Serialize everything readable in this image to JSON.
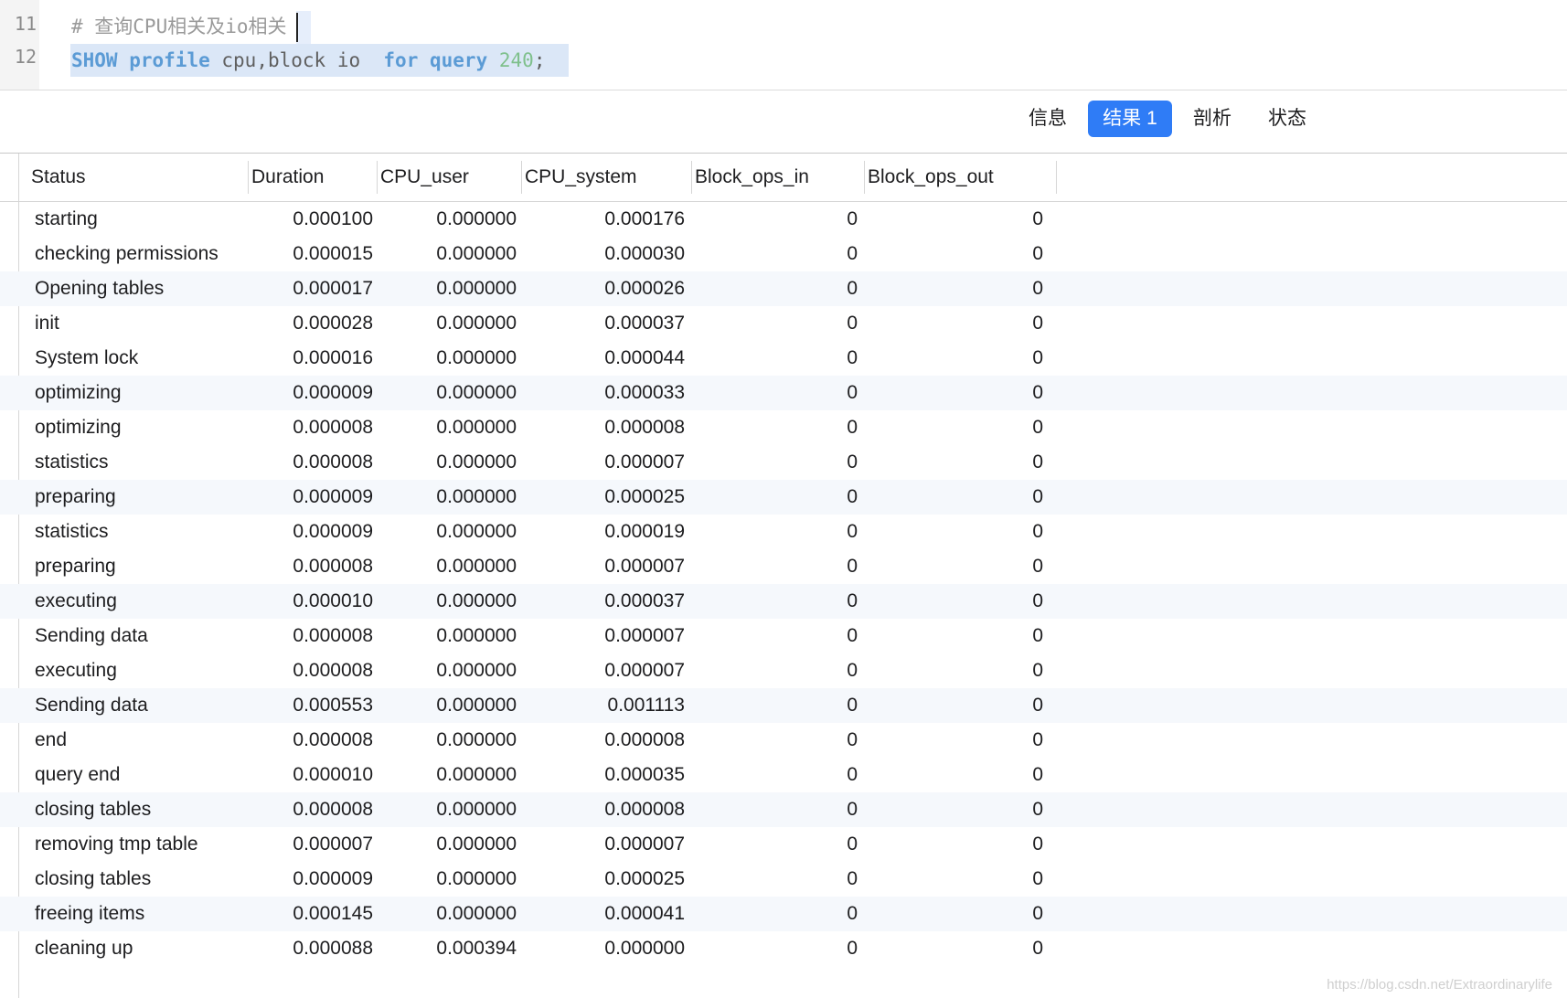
{
  "editor": {
    "lines": [
      {
        "num": "11",
        "comment": "# 查询CPU相关及io相关"
      },
      {
        "num": "12",
        "tokens": [
          {
            "t": "SHOW",
            "k": "kw"
          },
          {
            "t": " ",
            "k": "plain"
          },
          {
            "t": "profile",
            "k": "kw"
          },
          {
            "t": " cpu,block io  ",
            "k": "plain"
          },
          {
            "t": "for",
            "k": "kw"
          },
          {
            "t": " ",
            "k": "plain"
          },
          {
            "t": "query",
            "k": "kw"
          },
          {
            "t": " ",
            "k": "plain"
          },
          {
            "t": "240",
            "k": "num"
          },
          {
            "t": ";",
            "k": "plain"
          }
        ]
      }
    ]
  },
  "tabs": [
    {
      "label": "信息",
      "active": false
    },
    {
      "label": "结果 1",
      "active": true
    },
    {
      "label": "剖析",
      "active": false
    },
    {
      "label": "状态",
      "active": false
    }
  ],
  "table": {
    "columns": [
      "Status",
      "Duration",
      "CPU_user",
      "CPU_system",
      "Block_ops_in",
      "Block_ops_out"
    ],
    "rows": [
      [
        "starting",
        "0.000100",
        "0.000000",
        "0.000176",
        "0",
        "0"
      ],
      [
        "checking permissions",
        "0.000015",
        "0.000000",
        "0.000030",
        "0",
        "0"
      ],
      [
        "Opening tables",
        "0.000017",
        "0.000000",
        "0.000026",
        "0",
        "0"
      ],
      [
        "init",
        "0.000028",
        "0.000000",
        "0.000037",
        "0",
        "0"
      ],
      [
        "System lock",
        "0.000016",
        "0.000000",
        "0.000044",
        "0",
        "0"
      ],
      [
        "optimizing",
        "0.000009",
        "0.000000",
        "0.000033",
        "0",
        "0"
      ],
      [
        "optimizing",
        "0.000008",
        "0.000000",
        "0.000008",
        "0",
        "0"
      ],
      [
        "statistics",
        "0.000008",
        "0.000000",
        "0.000007",
        "0",
        "0"
      ],
      [
        "preparing",
        "0.000009",
        "0.000000",
        "0.000025",
        "0",
        "0"
      ],
      [
        "statistics",
        "0.000009",
        "0.000000",
        "0.000019",
        "0",
        "0"
      ],
      [
        "preparing",
        "0.000008",
        "0.000000",
        "0.000007",
        "0",
        "0"
      ],
      [
        "executing",
        "0.000010",
        "0.000000",
        "0.000037",
        "0",
        "0"
      ],
      [
        "Sending data",
        "0.000008",
        "0.000000",
        "0.000007",
        "0",
        "0"
      ],
      [
        "executing",
        "0.000008",
        "0.000000",
        "0.000007",
        "0",
        "0"
      ],
      [
        "Sending data",
        "0.000553",
        "0.000000",
        "0.001113",
        "0",
        "0"
      ],
      [
        "end",
        "0.000008",
        "0.000000",
        "0.000008",
        "0",
        "0"
      ],
      [
        "query end",
        "0.000010",
        "0.000000",
        "0.000035",
        "0",
        "0"
      ],
      [
        "closing tables",
        "0.000008",
        "0.000000",
        "0.000008",
        "0",
        "0"
      ],
      [
        "removing tmp table",
        "0.000007",
        "0.000000",
        "0.000007",
        "0",
        "0"
      ],
      [
        "closing tables",
        "0.000009",
        "0.000000",
        "0.000025",
        "0",
        "0"
      ],
      [
        "freeing items",
        "0.000145",
        "0.000000",
        "0.000041",
        "0",
        "0"
      ],
      [
        "cleaning up",
        "0.000088",
        "0.000394",
        "0.000000",
        "0",
        "0"
      ]
    ]
  },
  "watermark": "https://blog.csdn.net/Extraordinarylife",
  "colors": {
    "accent": "#2f7cf6",
    "row_alt": "#f5f8fc",
    "keyword": "#5b9bd5",
    "number": "#7fc08c",
    "selection": "#dbe7f7"
  }
}
